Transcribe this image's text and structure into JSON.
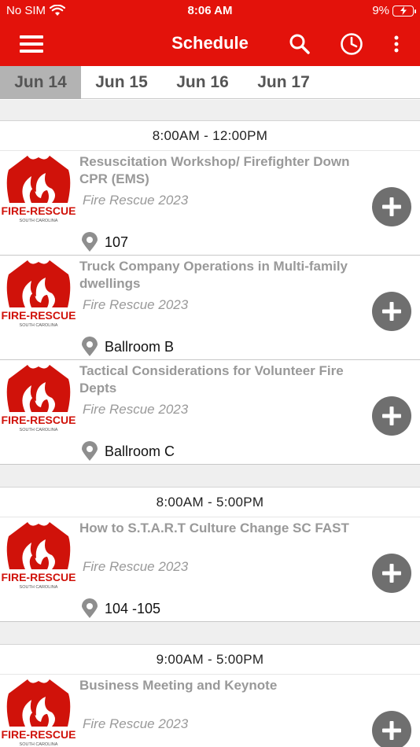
{
  "status_bar": {
    "carrier": "No SIM",
    "time": "8:06 AM",
    "battery_percent": "9%",
    "battery_level": 0.09
  },
  "app_bar": {
    "title": "Schedule"
  },
  "date_tabs": [
    {
      "label": "Jun 14",
      "selected": true
    },
    {
      "label": "Jun 15",
      "selected": false
    },
    {
      "label": "Jun 16",
      "selected": false
    },
    {
      "label": "Jun 17",
      "selected": false
    }
  ],
  "logo": {
    "text": "FIRE-RESCUE",
    "subtext": "SOUTH CAROLINA"
  },
  "groups": [
    {
      "time_range": "8:00AM - 12:00PM",
      "sessions": [
        {
          "title": "Resuscitation Workshop/ Firefighter Down CPR (EMS)",
          "organization": "Fire Rescue 2023",
          "location": "107"
        },
        {
          "title": "Truck Company Operations in Multi-family dwellings",
          "organization": "Fire Rescue 2023",
          "location": "Ballroom B"
        },
        {
          "title": "Tactical Considerations for Volunteer Fire Depts",
          "organization": "Fire Rescue 2023",
          "location": "Ballroom C"
        }
      ]
    },
    {
      "time_range": "8:00AM - 5:00PM",
      "sessions": [
        {
          "title": "How to S.T.A.R.T Culture Change SC FAST",
          "organization": "Fire Rescue 2023",
          "location": "104 -105"
        }
      ]
    },
    {
      "time_range": "9:00AM - 5:00PM",
      "sessions": [
        {
          "title": "Business Meeting and Keynote",
          "organization": "Fire Rescue 2023",
          "location": ""
        }
      ]
    }
  ],
  "colors": {
    "brand_red": "#e3120b",
    "add_button": "#6f6f6f",
    "muted_text": "#999999"
  }
}
